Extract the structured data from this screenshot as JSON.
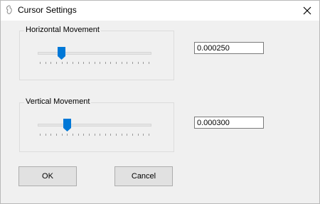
{
  "window": {
    "title": "Cursor Settings"
  },
  "horizontal": {
    "label": "Horizontal Movement",
    "value": "0.000250",
    "slider_fraction": 0.2
  },
  "vertical": {
    "label": "Vertical Movement",
    "value": "0.000300",
    "slider_fraction": 0.25
  },
  "buttons": {
    "ok": "OK",
    "cancel": "Cancel"
  },
  "icons": {
    "app": "app-icon",
    "close": "close-icon",
    "thumb": "slider-thumb"
  },
  "colors": {
    "accent": "#0078d7",
    "background": "#f0f0f0",
    "titlebar": "#ffffff"
  }
}
